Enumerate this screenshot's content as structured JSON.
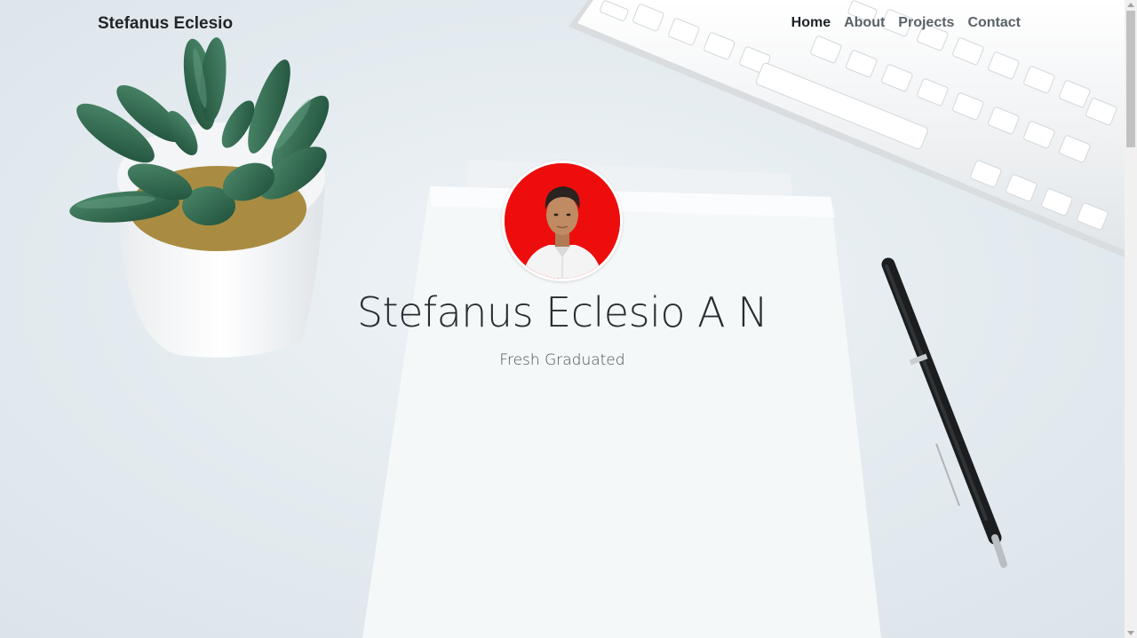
{
  "navbar": {
    "brand": "Stefanus Eclesio",
    "links": [
      {
        "label": "Home",
        "active": true
      },
      {
        "label": "About",
        "active": false
      },
      {
        "label": "Projects",
        "active": false
      },
      {
        "label": "Contact",
        "active": false
      }
    ]
  },
  "hero": {
    "name": "Stefanus Eclesio A N",
    "role": "Fresh Graduated"
  },
  "colors": {
    "avatar_background": "#ee0d0d",
    "background": "#e4ebef"
  },
  "icons": {
    "background_photo": "desk-scene-with-plant-keyboard-paper-pen",
    "avatar": "profile-photo"
  }
}
